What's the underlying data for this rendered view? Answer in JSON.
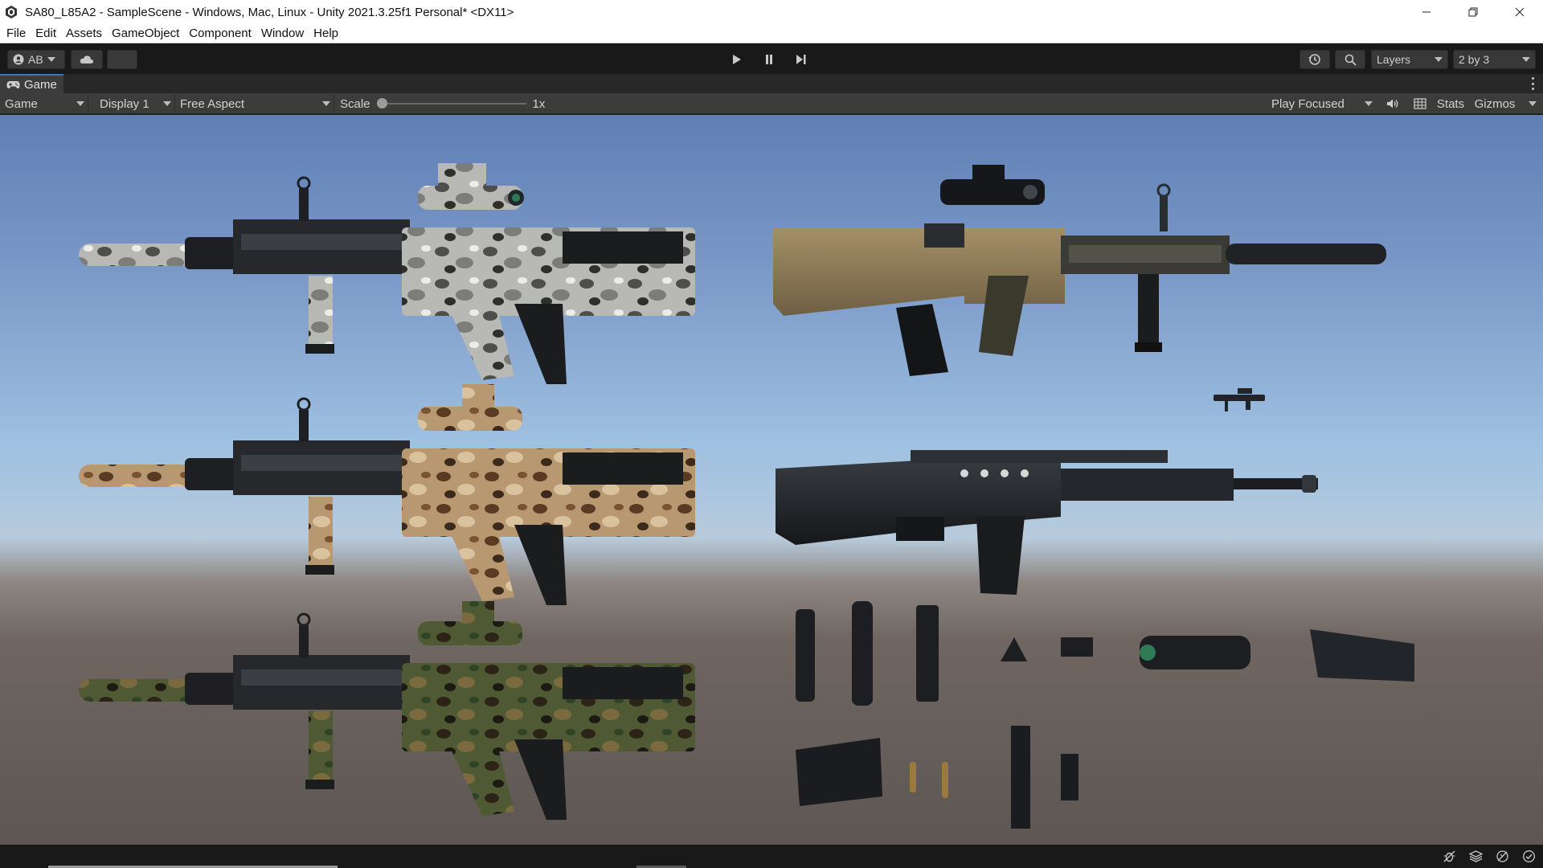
{
  "window": {
    "title": "SA80_L85A2 - SampleScene - Windows, Mac, Linux - Unity 2021.3.25f1 Personal* <DX11>",
    "icons": {
      "app": "unity-logo-icon",
      "minimize": "minimize-icon",
      "restore": "restore-icon",
      "close": "close-icon"
    }
  },
  "menubar": {
    "items": [
      {
        "label": "File"
      },
      {
        "label": "Edit"
      },
      {
        "label": "Assets"
      },
      {
        "label": "GameObject"
      },
      {
        "label": "Component"
      },
      {
        "label": "Window"
      },
      {
        "label": "Help"
      }
    ]
  },
  "toolbar": {
    "account_label": "AB",
    "account_icon": "account-icon",
    "cloud_icon": "cloud-icon",
    "play_icon": "play-icon",
    "pause_icon": "pause-icon",
    "step_icon": "step-icon",
    "history_icon": "history-icon",
    "search_icon": "search-icon",
    "layers_label": "Layers",
    "layout_label": "2 by 3"
  },
  "game_tab": {
    "label": "Game",
    "icon": "gamepad-icon"
  },
  "game_view": {
    "mode_label": "Game",
    "display_label": "Display 1",
    "aspect_label": "Free Aspect",
    "scale_label": "Scale",
    "scale_value": "1x",
    "scale_fraction": 0.0,
    "play_mode_label": "Play Focused",
    "audio_icon": "speaker-icon",
    "grid_icon": "grid-icon",
    "stats_label": "Stats",
    "gizmos_label": "Gizmos"
  },
  "status_icons": [
    "bug-icon",
    "layers-stack-icon",
    "lighting-icon",
    "checkmark-icon"
  ],
  "colors": {
    "accent": "#3a79bb",
    "toolbar_bg": "#191919",
    "panel_bg": "#3c3c3c",
    "sky_top": "#5f7fb4",
    "ground": "#5d5653"
  }
}
